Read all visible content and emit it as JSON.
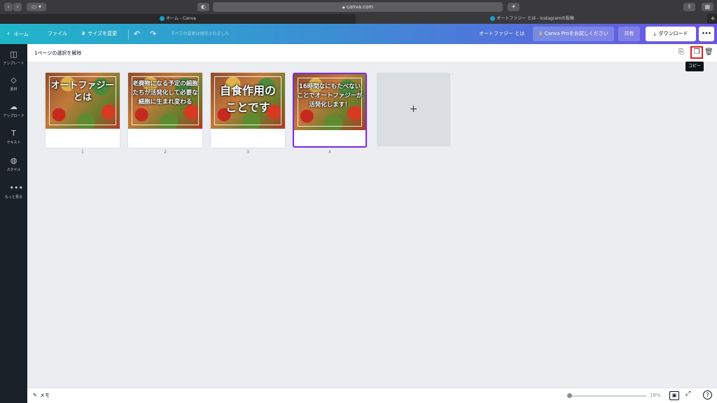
{
  "browser": {
    "address": "canva.com",
    "tabs": [
      {
        "label": "ホーム - Canva"
      },
      {
        "label": "オートファジー とは - Instagramの投稿"
      }
    ],
    "new_tab": "+"
  },
  "toolbar": {
    "home": "ホーム",
    "file": "ファイル",
    "resize": "サイズを変更",
    "save_status": "すべての変更は保存されました",
    "doc_title": "オートファジー とは",
    "pro_trial": "Canva Proをお試しください",
    "share": "共有",
    "download": "ダウンロード",
    "more": "•••"
  },
  "rail": {
    "items": [
      {
        "label": "テンプレート",
        "icon": "template-icon"
      },
      {
        "label": "素材",
        "icon": "elements-icon"
      },
      {
        "label": "アップロード",
        "icon": "upload-icon"
      },
      {
        "label": "テキスト",
        "icon": "text-icon"
      },
      {
        "label": "スタイル",
        "icon": "palette-icon"
      },
      {
        "label": "もっと見る",
        "icon": "more-dots-icon"
      }
    ]
  },
  "subbar": {
    "deselect": "1ページの選択を解除",
    "tooltip": "コピー"
  },
  "pages": [
    {
      "number": "1",
      "caption": "オートファジー とは",
      "selected": false
    },
    {
      "number": "2",
      "caption": "老廃物になる予定の細胞たちが活発化して必要な細胞に生まれ変わる",
      "selected": false
    },
    {
      "number": "3",
      "caption": "自食作用のことです",
      "selected": false
    },
    {
      "number": "4",
      "caption": "16時間なにもたべないことでオートファジーが活発化します！",
      "selected": true
    }
  ],
  "add_page": "+",
  "bottom": {
    "notes": "メモ",
    "zoom": "18%",
    "zoom_fraction": 0.18,
    "help": "?"
  },
  "colors": {
    "accent": "#7d2ae8",
    "highlight": "#e02020",
    "rail_bg": "#1b2128"
  }
}
